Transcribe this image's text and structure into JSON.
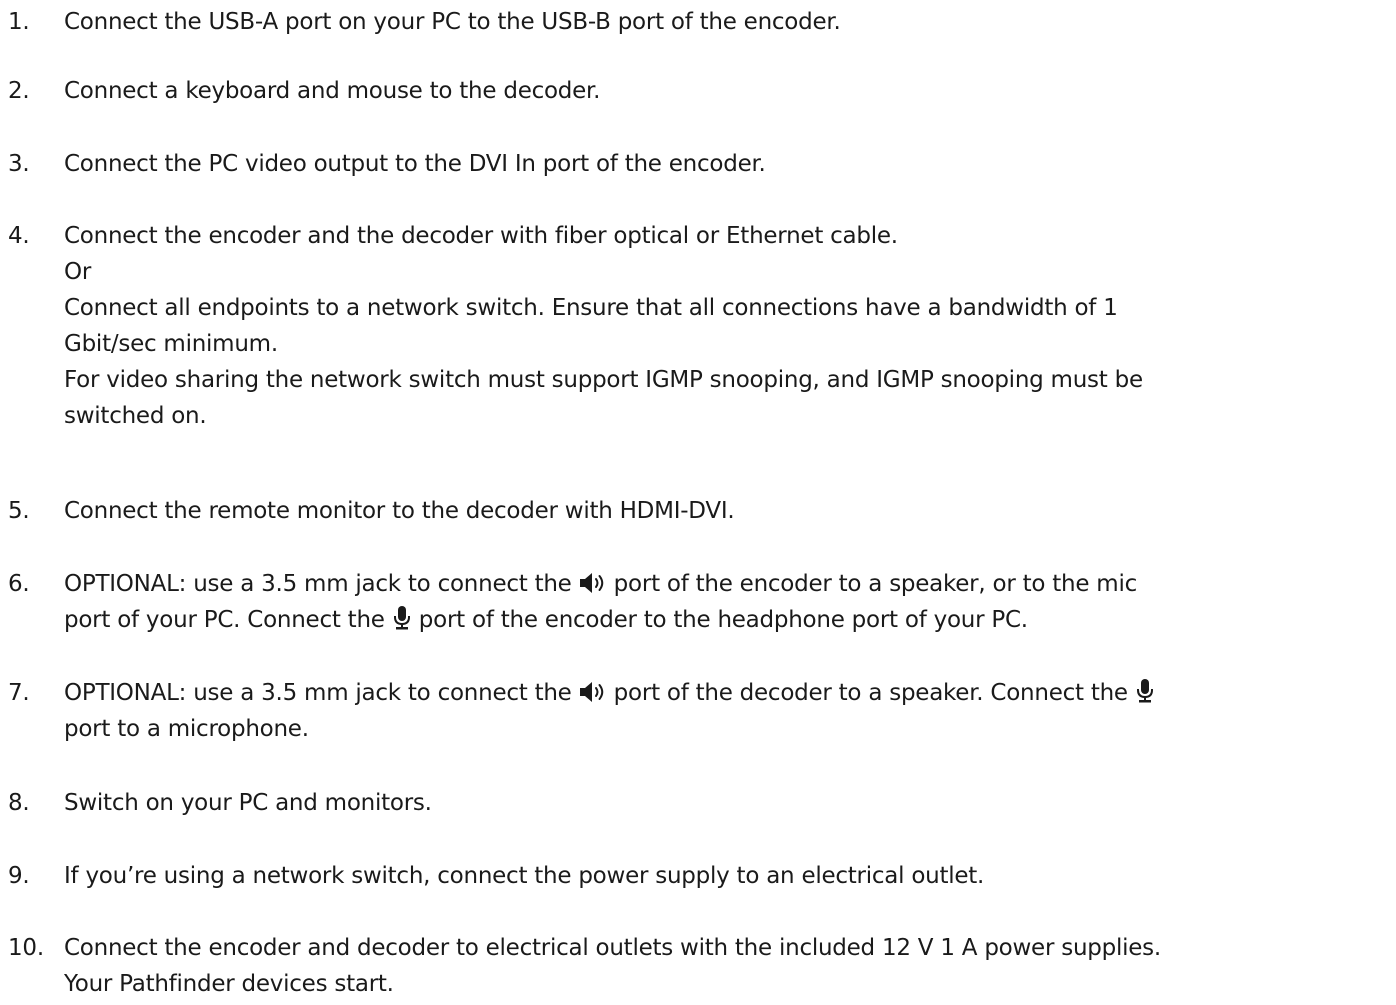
{
  "steps": [
    {
      "number": "1.",
      "lines": [
        "Connect the USB-A port on your PC to the USB-B port of the encoder."
      ]
    },
    {
      "number": "2.",
      "lines": [
        "Connect a keyboard and mouse to the decoder."
      ]
    },
    {
      "number": "3.",
      "lines": [
        "Connect the PC video output to the DVI In port of the encoder."
      ]
    },
    {
      "number": "4.",
      "lines": [
        "Connect the encoder and the decoder with fiber optical or Ethernet cable.",
        "Or",
        "Connect all endpoints to a network switch. Ensure that all connections have a bandwidth of 1",
        "Gbit/sec minimum.",
        "For video sharing the network switch must support IGMP snooping, and IGMP snooping must be",
        "switched on."
      ]
    },
    {
      "number": "5.",
      "lines": [
        "Connect the remote monitor to the decoder with HDMI-DVI."
      ]
    },
    {
      "number": "6.",
      "line1_pre": "OPTIONAL: use a 3.5 mm jack to connect the ",
      "line1_post": " port of the encoder to a speaker, or to the mic",
      "line2_pre": "port of your PC. Connect the ",
      "line2_post": " port of the encoder to the headphone port of your PC."
    },
    {
      "number": "7.",
      "line1_pre": "OPTIONAL: use a 3.5 mm jack to connect the ",
      "line1_mid": " port of the decoder to a speaker. Connect the ",
      "line2": "port to a microphone."
    },
    {
      "number": "8.",
      "lines": [
        "Switch on your PC and monitors."
      ]
    },
    {
      "number": "9.",
      "lines": [
        "If you’re using a network switch, connect the power supply to an electrical outlet."
      ]
    },
    {
      "number": "10.",
      "lines": [
        "Connect the encoder and decoder to electrical outlets with the included 12 V 1 A power supplies.",
        "Your Pathfinder devices start."
      ]
    }
  ],
  "icons": {
    "speaker": "speaker-icon",
    "microphone": "microphone-icon"
  },
  "colors": {
    "text": "#1a1a1a",
    "background": "#ffffff"
  }
}
